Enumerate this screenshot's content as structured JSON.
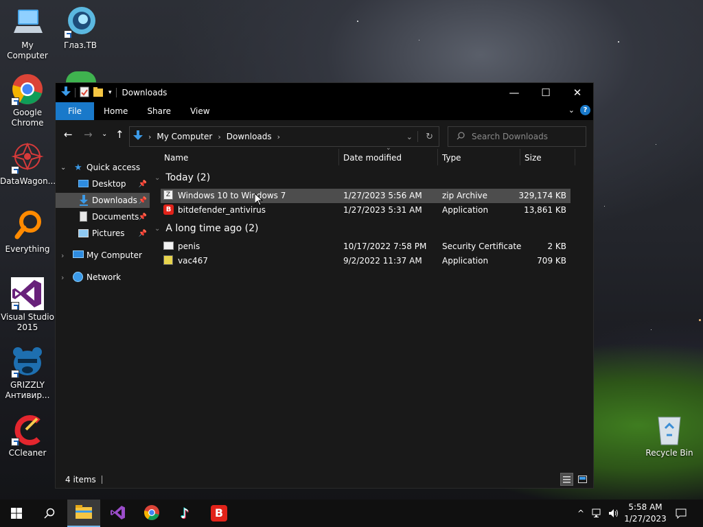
{
  "desktop": {
    "icons": [
      {
        "label": "My Computer",
        "icon": "computer-icon"
      },
      {
        "label": "Глаз.ТВ",
        "icon": "eye-tv-icon"
      },
      {
        "label": "Google Chrome",
        "icon": "chrome-icon"
      },
      {
        "label": "DataWagon...",
        "icon": "datawagon-icon"
      },
      {
        "label": "Everything",
        "icon": "everything-icon"
      },
      {
        "label": "Visual Studio 2015",
        "icon": "visual-studio-icon"
      },
      {
        "label": "GRIZZLY Антивир...",
        "icon": "grizzly-icon"
      },
      {
        "label": "CCleaner",
        "icon": "ccleaner-icon"
      },
      {
        "label": "Recycle Bin",
        "icon": "recycle-bin-icon"
      }
    ]
  },
  "window": {
    "title": "Downloads",
    "controls": {
      "minimize": "—",
      "maximize": "☐",
      "close": "✕"
    },
    "ribbon": {
      "tabs": [
        "File",
        "Home",
        "Share",
        "View"
      ]
    },
    "address": {
      "crumbs": [
        "My Computer",
        "Downloads"
      ]
    },
    "search": {
      "placeholder": "Search Downloads"
    },
    "sidebar": {
      "items": [
        {
          "label": "Quick access"
        },
        {
          "label": "Desktop"
        },
        {
          "label": "Downloads"
        },
        {
          "label": "Documents"
        },
        {
          "label": "Pictures"
        },
        {
          "label": "My Computer"
        },
        {
          "label": "Network"
        }
      ]
    },
    "columns": [
      "Name",
      "Date modified",
      "Type",
      "Size"
    ],
    "groups": [
      {
        "title": "Today (2)",
        "files": [
          {
            "name": "Windows 10 to Windows 7",
            "date": "1/27/2023 5:56 AM",
            "type": "zip Archive",
            "size": "329,174 KB",
            "icon": "zip-archive-icon"
          },
          {
            "name": "bitdefender_antivirus",
            "date": "1/27/2023 5:31 AM",
            "type": "Application",
            "size": "13,861 KB",
            "icon": "bitdefender-icon"
          }
        ]
      },
      {
        "title": "A long time ago (2)",
        "files": [
          {
            "name": "penis",
            "date": "10/17/2022 7:58 PM",
            "type": "Security Certificate",
            "size": "2 KB",
            "icon": "certificate-icon"
          },
          {
            "name": "vac467",
            "date": "9/2/2022 11:37 AM",
            "type": "Application",
            "size": "709 KB",
            "icon": "application-icon"
          }
        ]
      }
    ],
    "status": {
      "item_count": "4 items"
    }
  },
  "taskbar": {
    "apps": [
      "file-explorer-icon",
      "visual-studio-icon",
      "chrome-icon",
      "tiktok-icon",
      "bitdefender-icon"
    ],
    "clock": {
      "time": "5:58 AM",
      "date": "1/27/2023"
    }
  }
}
